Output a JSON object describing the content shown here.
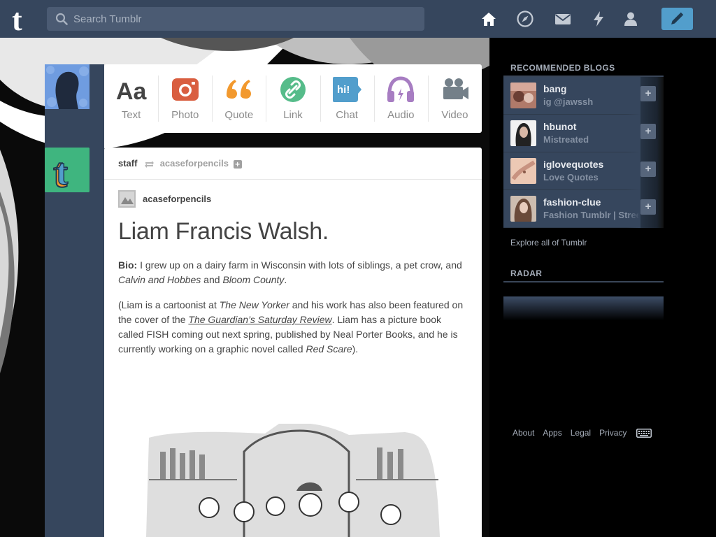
{
  "header": {
    "logo": "tumblr-logo",
    "search_placeholder": "Search Tumblr",
    "nav_icons": [
      "home-icon",
      "explore-icon",
      "inbox-icon",
      "activity-icon",
      "account-icon"
    ],
    "compose_icon": "pencil-icon"
  },
  "post_types": [
    {
      "label": "Text",
      "icon": "text-icon",
      "color": "#444444"
    },
    {
      "label": "Photo",
      "icon": "camera-icon",
      "color": "#d95e40"
    },
    {
      "label": "Quote",
      "icon": "quote-icon",
      "color": "#f2992e"
    },
    {
      "label": "Link",
      "icon": "link-icon",
      "color": "#56bc8a"
    },
    {
      "label": "Chat",
      "icon": "chat-icon",
      "color": "#529ecc"
    },
    {
      "label": "Audio",
      "icon": "headphones-icon",
      "color": "#a77dc2"
    },
    {
      "label": "Video",
      "icon": "video-camera-icon",
      "color": "#748089"
    }
  ],
  "post": {
    "author": "staff",
    "source": "acaseforpencils",
    "reblog_from": "acaseforpencils",
    "title": "Liam Francis Walsh.",
    "bio_label": "Bio:",
    "bio_text": " I grew up on a dairy farm in Wisconsin with lots of siblings, a pet crow, and ",
    "bio_italic_1": "Calvin and Hobbes",
    "bio_and": " and ",
    "bio_italic_2": "Bloom County",
    "bio_end": ".",
    "p2_a": "(Liam is a cartoonist at ",
    "p2_i1": "The New Yorker",
    "p2_b": " and his work has also been featured on the cover of the ",
    "p2_i2": "The Guardian’s Saturday Review",
    "p2_c": ". Liam has a picture book called FISH coming out next spring, published by Neal Porter Books, and he is currently working on a graphic novel called ",
    "p2_i3": "Red Scare",
    "p2_d": ")."
  },
  "sidebar": {
    "recommended_title": "RECOMMENDED BLOGS",
    "blogs": [
      {
        "name": "bang",
        "desc": "ig @jawssh",
        "avatar_color": "#b07a6a"
      },
      {
        "name": "hbunot",
        "desc": "Mistreated",
        "avatar_color": "#3a3a3a"
      },
      {
        "name": "iglovequotes",
        "desc": "Love Quotes",
        "avatar_color": "#e6b9a4"
      },
      {
        "name": "fashion-clue",
        "desc": "Fashion Tumblr | Street",
        "avatar_color": "#9a8174"
      }
    ],
    "explore_label": "Explore all of Tumblr",
    "radar_title": "RADAR"
  },
  "footer": {
    "links": [
      "About",
      "Apps",
      "Legal",
      "Privacy"
    ],
    "keyboard_icon": "keyboard-icon"
  }
}
